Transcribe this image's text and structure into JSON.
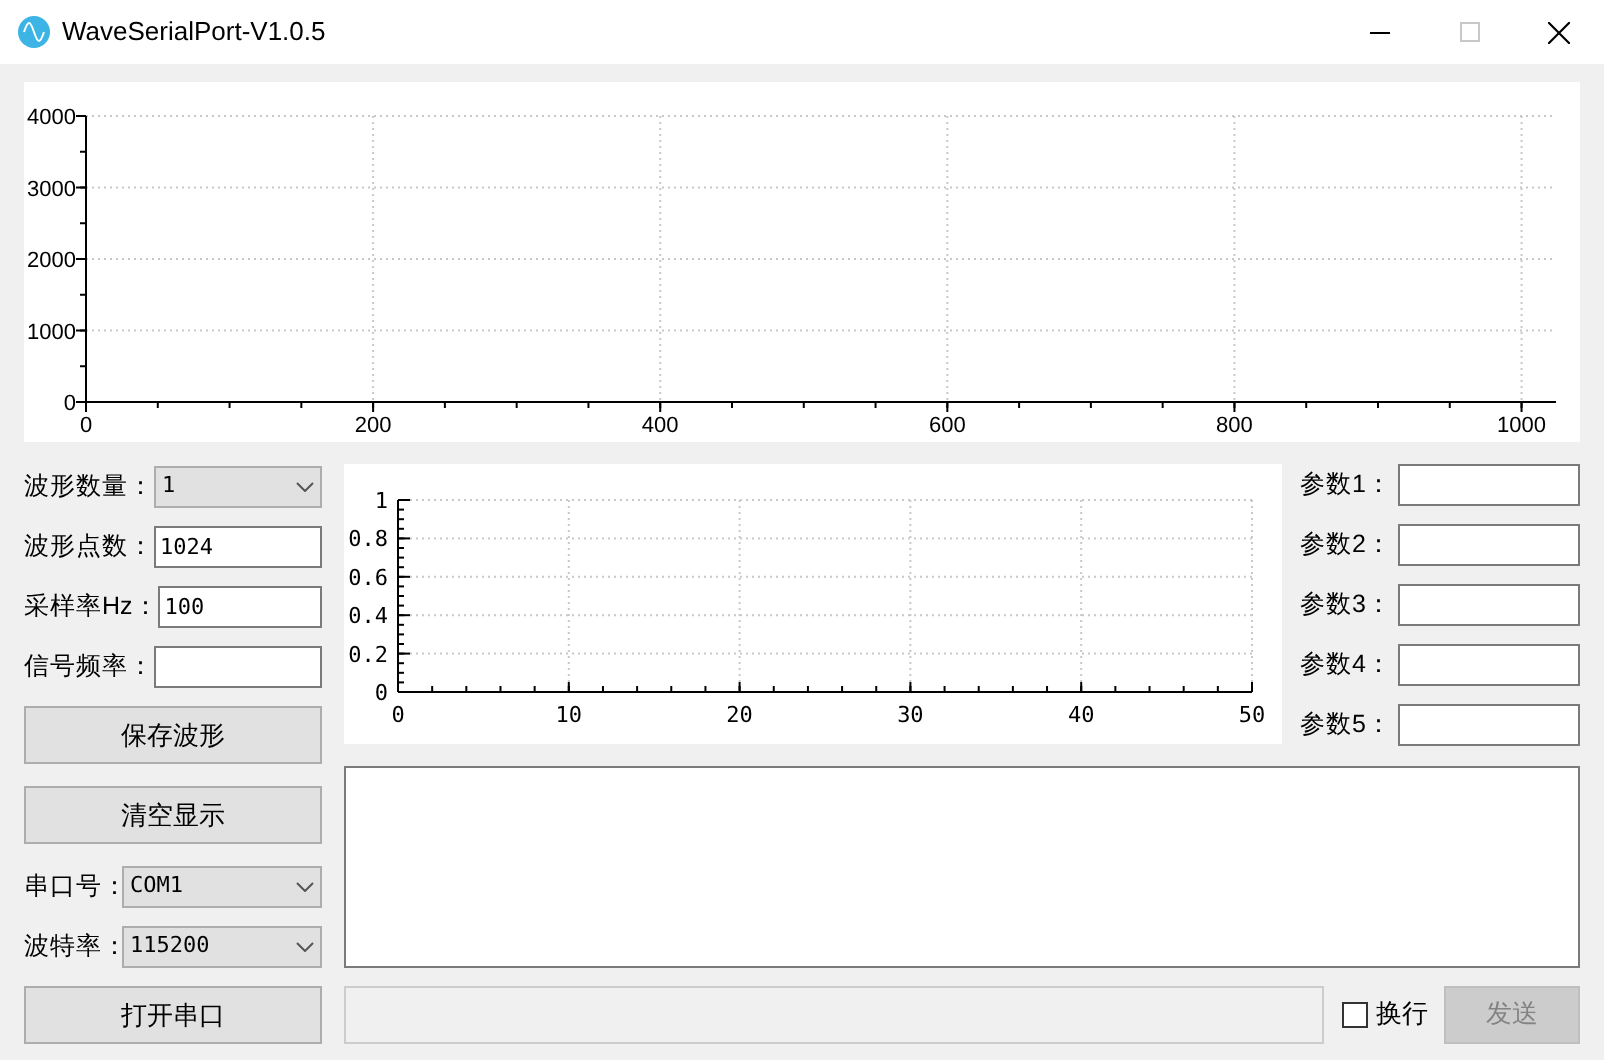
{
  "window": {
    "title": "WaveSerialPort-V1.0.5"
  },
  "wave_chart": {
    "chart_data": {
      "type": "line",
      "xlim": [
        0,
        1024
      ],
      "ylim": [
        0,
        4000
      ],
      "xticks": [
        0,
        200,
        400,
        600,
        800,
        1000
      ],
      "yticks": [
        0,
        1000,
        2000,
        3000,
        4000
      ],
      "grid": true
    }
  },
  "settings": [
    {
      "kind": "select",
      "label": "波形数量：",
      "value": "1"
    },
    {
      "kind": "input",
      "label": "波形点数：",
      "value": "1024"
    },
    {
      "kind": "input",
      "label": "采样率Hz：",
      "value": "100"
    },
    {
      "kind": "input",
      "label": "信号频率："
    }
  ],
  "actions": [
    "保存波形",
    "清空显示"
  ],
  "serial": [
    {
      "label": "串口号：",
      "value": "COM1"
    },
    {
      "label": "波特率：",
      "value": "115200"
    }
  ],
  "open_button": "打开串口",
  "small_chart": {
    "chart_data": {
      "type": "line",
      "xlim": [
        0,
        50
      ],
      "ylim": [
        0,
        1
      ],
      "xticks": [
        0,
        10,
        20,
        30,
        40,
        50
      ],
      "yticks": [
        0,
        0.2,
        0.4,
        0.6,
        0.8,
        1
      ],
      "grid": true
    }
  },
  "params": [
    {
      "label": "参数1："
    },
    {
      "label": "参数2："
    },
    {
      "label": "参数3："
    },
    {
      "label": "参数4："
    },
    {
      "label": "参数5："
    }
  ],
  "send": {
    "newline": {
      "label": "换行",
      "checked": false
    },
    "send_button": {
      "label": "发送",
      "disabled": true
    }
  }
}
